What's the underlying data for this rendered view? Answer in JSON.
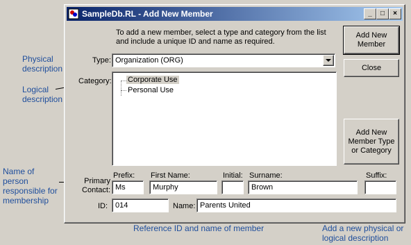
{
  "annotations": {
    "physical_description": "Physical description",
    "logical_description": "Logical description",
    "person_responsible": "Name of person responsible for membership",
    "reference_id_name": "Reference ID and name of member",
    "add_physical_logical": "Add a new physical or logical description"
  },
  "window": {
    "title": "SampleDb.RL - Add New Member",
    "minimize": "_",
    "maximize": "□",
    "close": "×"
  },
  "instructions": "To add a new member, select a type and category from the list and include a unique ID and name as required.",
  "type": {
    "label": "Type:",
    "value": "Organization (ORG)"
  },
  "category": {
    "label": "Category:",
    "items": [
      "Corporate Use",
      "Personal Use"
    ]
  },
  "buttons": {
    "add_new_member": "Add New Member",
    "close": "Close",
    "add_new_member_type": "Add New Member Type or Category"
  },
  "contact": {
    "label": "Primary Contact:",
    "prefix_label": "Prefix:",
    "prefix": "Ms",
    "first_name_label": "First Name:",
    "first_name": "Murphy",
    "initial_label": "Initial:",
    "initial": "",
    "surname_label": "Surname:",
    "surname": "Brown",
    "suffix_label": "Suffix:",
    "suffix": ""
  },
  "id": {
    "label": "ID:",
    "value": "014"
  },
  "name": {
    "label": "Name:",
    "value": "Parents United"
  }
}
